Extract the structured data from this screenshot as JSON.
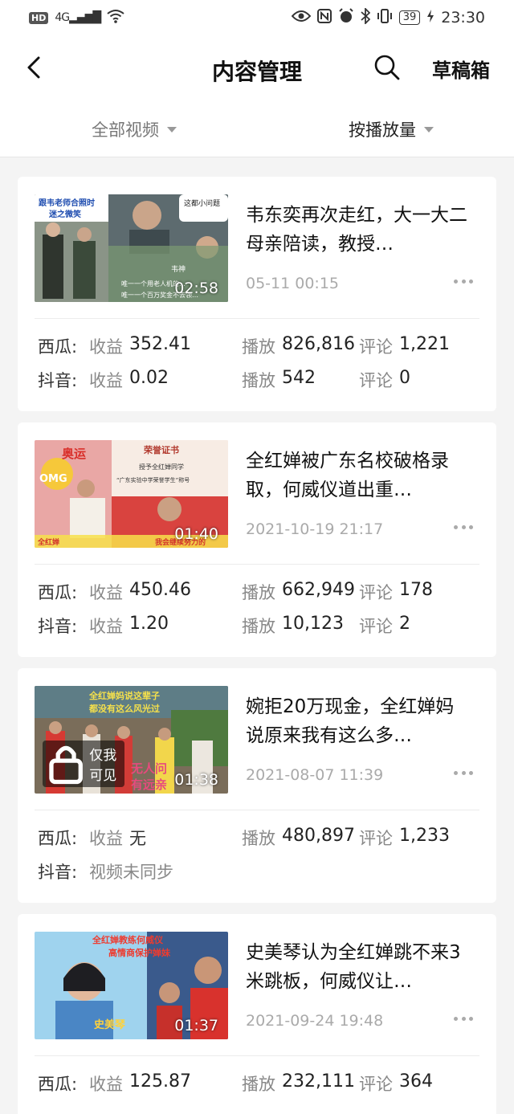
{
  "status_bar": {
    "hd": "HD",
    "signal": "4G",
    "battery": "39",
    "time": "23:30"
  },
  "header": {
    "title": "内容管理",
    "drafts_label": "草稿箱"
  },
  "filters": {
    "category": "全部视频",
    "sort": "按播放量"
  },
  "labels": {
    "revenue": "收益",
    "plays": "播放",
    "comments": "评论",
    "none": "无",
    "not_synced": "视频未同步",
    "private": "仅我可见"
  },
  "videos": [
    {
      "title": "韦东奕再次走红，大一大二母亲陪读，教授…",
      "date": "05-11 00:15",
      "duration": "02:58",
      "thumb_text": [
        "跟韦老师合照时",
        "迷之微笑",
        "这都小问题",
        "韦神",
        "唯一一个用老人机的…",
        "唯一一个百万奖金不去领…"
      ],
      "xigua": {
        "platform": "西瓜:",
        "revenue": "352.41",
        "plays": "826,816",
        "comments": "1,221"
      },
      "douyin": {
        "platform": "抖音:",
        "revenue": "0.02",
        "plays": "542",
        "comments": "0"
      }
    },
    {
      "title": "全红婵被广东名校破格录取，何威仪道出重…",
      "date": "2021-10-19 21:17",
      "duration": "01:40",
      "thumb_text": [
        "奥运",
        "OMG",
        "荣誉证书",
        "授予全红婵同学",
        "“广东实验中学荣誉学生”称号",
        "全红婵",
        "我会继续努力的"
      ],
      "xigua": {
        "platform": "西瓜:",
        "revenue": "450.46",
        "plays": "662,949",
        "comments": "178"
      },
      "douyin": {
        "platform": "抖音:",
        "revenue": "1.20",
        "plays": "10,123",
        "comments": "2"
      }
    },
    {
      "title": "婉拒20万现金，全红婵妈说原来我有这么多…",
      "date": "2021-08-07 11:39",
      "duration": "01:38",
      "is_private": true,
      "thumb_text": [
        "全红婵妈说这辈子",
        "都没有这么风光过",
        "无人问",
        "有远亲"
      ],
      "xigua": {
        "platform": "西瓜:",
        "plays": "480,897",
        "comments": "1,233"
      },
      "douyin": {
        "platform": "抖音:"
      }
    },
    {
      "title": "史美琴认为全红婵跳不来3米跳板，何威仪让…",
      "date": "2021-09-24 19:48",
      "duration": "01:37",
      "thumb_text": [
        "全红婵教练何威仪",
        "高情商保护婵妹",
        "史美琴"
      ],
      "xigua": {
        "platform": "西瓜:",
        "revenue": "125.87",
        "plays": "232,111",
        "comments": "364"
      }
    }
  ]
}
